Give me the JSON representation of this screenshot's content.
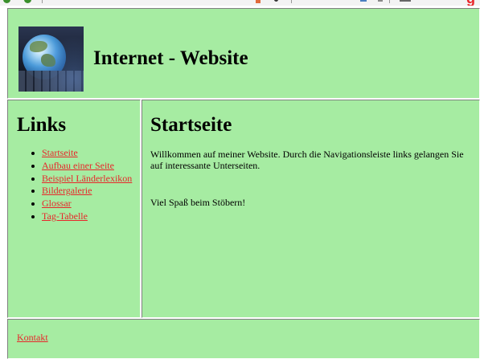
{
  "header": {
    "title": "Internet - Website"
  },
  "sidebar": {
    "heading": "Links",
    "links": [
      {
        "label": "Startseite"
      },
      {
        "label": "Aufbau einer Seite"
      },
      {
        "label": "Beispiel Länderlexikon"
      },
      {
        "label": "Bildergalerie"
      },
      {
        "label": "Glossar"
      },
      {
        "label": "Tag-Tabelle"
      }
    ]
  },
  "main": {
    "heading": "Startseite",
    "intro": "Willkommen auf meiner Website. Durch die Navigationsleiste links gelangen Sie auf interessante Unterseiten.",
    "closing": "Viel Spaß beim Stöbern!"
  },
  "footer": {
    "link_label": "Kontakt"
  },
  "colors": {
    "frame_background": "#a6eca2",
    "link": "#e8262a"
  },
  "icons": {
    "logo": "globe-keyboard-image"
  }
}
